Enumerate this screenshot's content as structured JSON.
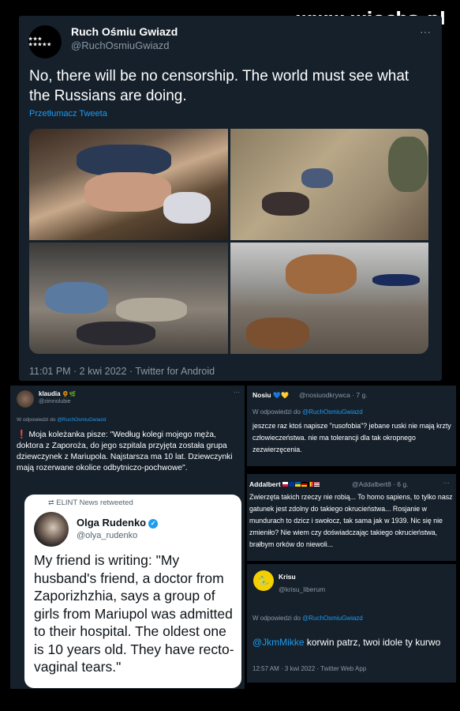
{
  "watermark": "www.wiocha.pl",
  "main_tweet": {
    "avatar_text": "★★★ ★★★★★",
    "name": "Ruch Ośmiu Gwiazd",
    "handle": "@RuchOsmiuGwiazd",
    "more": "···",
    "text": "No, there will be no censorship. The world must see what the Russians are doing.",
    "translate": "Przetłumacz Tweeta",
    "meta": "11:01 PM · 2 kwi 2022 · Twitter for Android"
  },
  "left_reply": {
    "name": "klaudia",
    "name_emoji": "🌻🌿",
    "handle": "@zimnolubie",
    "more": "···",
    "in_reply_prefix": "W odpowiedzi do ",
    "in_reply_handle": "@RuchOsmiuGwiazd",
    "warn": "❗",
    "text": " Moja koleżanka pisze: \"Według kolegi mojego męża, doktora z Zaporoża, do jego szpitala przyjęta została grupa dziewczynek z Mariupola. Najstarsza ma 10 lat. Dziewczynki mają rozerwane okolice odbytniczo-pochwowe\".",
    "quoted": {
      "retweet_label": "⮂  ELINT News retweeted",
      "name": "Olga Rudenko",
      "verified": "✓",
      "handle": "@olya_rudenko",
      "text": "My friend is writing: \"My husband's friend, a doctor from Zaporizhzhia, says a group of girls from Mariupol was admitted to their hospital. The oldest one is 10 years old. They have recto-vaginal tears.\""
    }
  },
  "reply_nosiu": {
    "name": "Nosiu",
    "hearts": "💙💛",
    "handle": "@nosiuodkrywca · 7 g.",
    "in_reply_prefix": "W odpowiedzi do ",
    "in_reply_handle": "@RuchOsmiuGwiazd",
    "text": "jeszcze raz ktoś napisze \"rusofobia\"? jebane ruski nie mają krzty człowieczeństwa. nie ma tolerancji dla tak okropnego zezwierzęcenia."
  },
  "reply_addalbert": {
    "name": "Addalbert",
    "handle": "@Addalbert8 · 6 g.",
    "more": "···",
    "text": "Zwierzęta takich rzeczy nie robią... To homo sapiens, to tylko nasz gatunek jest zdolny do takiego okrucieństwa... Rosjanie w mundurach to dzicz i swołocz, tak sama jak w 1939. Nic się nie zmieniło? Nie wiem czy doświadczając takiego okrucieństwa, brałbym orków do niewoli..."
  },
  "reply_krisu": {
    "avatar": "🐍",
    "name": "Krisu",
    "handle": "@krisu_liberum",
    "in_reply_prefix": "W odpowiedzi do ",
    "in_reply_handle": "@RuchOsmiuGwiazd",
    "mention": "@JkmMikke",
    "text": " korwin patrz, twoi idole ty kurwo",
    "meta": "12:57 AM · 3 kwi 2022 · Twitter Web App"
  },
  "colors": {
    "card_bg": "#15202b",
    "link": "#1d9bf0",
    "muted": "#8b98a5"
  }
}
